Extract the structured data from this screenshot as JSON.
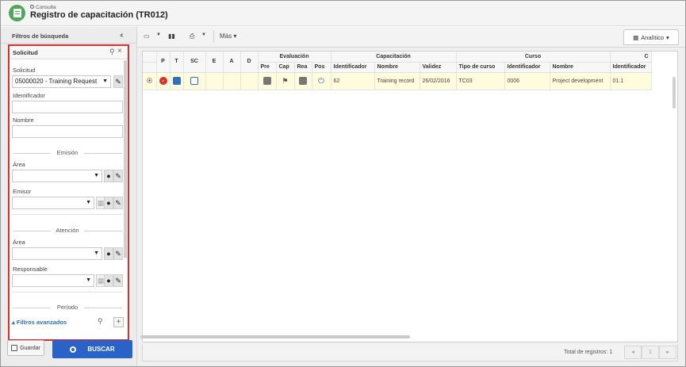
{
  "header": {
    "breadcrumb": "Consulta",
    "title": "Registro de capacitación (TR012)"
  },
  "left_panel": {
    "title": "Filtros de búsqueda",
    "filter_section": "Solicitud",
    "solicitud_label": "Solicitud",
    "solicitud_value": "05000020 - Training Request",
    "identificador_label": "Identificador",
    "identificador_value": "",
    "nombre_label": "Nombre",
    "nombre_value": "",
    "emision_section": "Emisión",
    "area_label": "Área",
    "area_value": "",
    "emisor_label": "Emisor",
    "emisor_value": "",
    "atencion_section": "Atención",
    "area2_label": "Área",
    "area2_value": "",
    "responsable_label": "Responsable",
    "responsable_value": "",
    "periodo_section": "Período",
    "advanced_filters": "Filtros avanzados",
    "save_label": "Guardar",
    "search_label": "BUSCAR"
  },
  "toolbar": {
    "more_label": "Más",
    "view_label": "Analítico"
  },
  "table": {
    "group_headers": [
      "Evaluación",
      "Capacitación",
      "Curso",
      "C"
    ],
    "columns": [
      "P",
      "T",
      "SC",
      "E",
      "A",
      "D",
      "Pre",
      "Cap",
      "Rea",
      "Pos",
      "Identificador",
      "Nombre",
      "Validez",
      "Tipo de curso",
      "Identificador",
      "Nombre",
      "Identificador"
    ],
    "rows": [
      {
        "cap_id": "62",
        "cap_name": "Training record",
        "validez": "26/02/2016",
        "tipo_curso": "TC03",
        "curso_id": "0006",
        "curso_name": "Project development",
        "c_id": "01.1"
      }
    ]
  },
  "footer": {
    "total_records": "Total de registros: 1",
    "page": "1"
  },
  "colors": {
    "accent_blue": "#2a63c8",
    "highlight_red": "#d23232",
    "row_highlight": "#fefcdc",
    "app_green": "#4ea85a"
  }
}
